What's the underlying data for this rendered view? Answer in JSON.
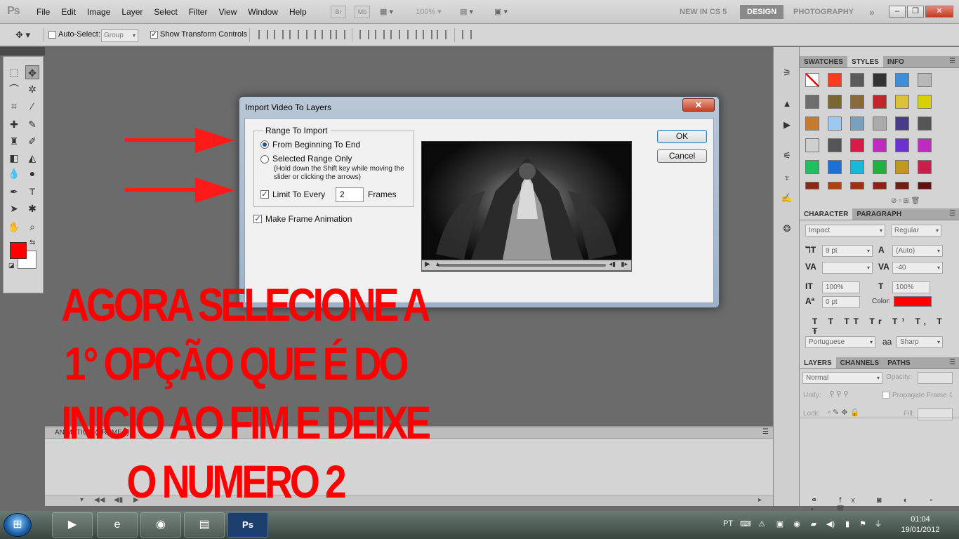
{
  "app": {
    "logo": "Ps",
    "menu": [
      "File",
      "Edit",
      "Image",
      "Layer",
      "Select",
      "Filter",
      "View",
      "Window",
      "Help"
    ],
    "bridge_btn": "Br",
    "minibridge_btn": "Mb",
    "zoom": "100%",
    "workspaces": [
      "NEW IN CS 5",
      "DESIGN",
      "PHOTOGRAPHY"
    ],
    "active_workspace": "DESIGN",
    "more": "»",
    "win_minimize": "–",
    "win_restore": "❐",
    "win_close": "✕"
  },
  "options_bar": {
    "auto_select_label": "Auto-Select:",
    "auto_select_checked": false,
    "group_value": "Group",
    "show_transform_label": "Show Transform Controls",
    "show_transform_checked": true
  },
  "animation_panel": {
    "title": "ANIMATION (FRAMES)"
  },
  "panels": {
    "swatches_tabs": [
      "SWATCHES",
      "STYLES",
      "INFO"
    ],
    "swatches_active": "STYLES",
    "character_tabs": [
      "CHARACTER",
      "PARAGRAPH"
    ],
    "character_active": "CHARACTER",
    "font_family": "Impact",
    "font_style": "Regular",
    "font_size": "9 pt",
    "leading": "(Auto)",
    "kerning": "",
    "tracking": "-40",
    "vertical_scale": "100%",
    "horizontal_scale": "100%",
    "baseline_shift": "0 pt",
    "color_label": "Color:",
    "text_color": "#ff0000",
    "language": "Portuguese",
    "aa_label": "aa",
    "antialias": "Sharp",
    "layers_tabs": [
      "LAYERS",
      "CHANNELS",
      "PATHS"
    ],
    "layers_active": "LAYERS",
    "blend_mode": "Normal",
    "opacity_label": "Opacity:",
    "unify_label": "Unify:",
    "propagate_label": "Propagate Frame 1",
    "lock_label": "Lock:",
    "fill_label": "Fill:"
  },
  "dialog": {
    "title": "Import Video To Layers",
    "close": "✕",
    "range_legend": "Range To Import",
    "option_all": "From Beginning To End",
    "option_all_selected": true,
    "option_range": "Selected Range Only",
    "option_range_selected": false,
    "hint": "(Hold down the Shift key while moving the slider or clicking the arrows)",
    "limit_label": "Limit To Every",
    "limit_checked": true,
    "limit_value": "2",
    "frames_label": "Frames",
    "make_anim_label": "Make Frame Animation",
    "make_anim_checked": true,
    "ok_label": "OK",
    "cancel_label": "Cancel"
  },
  "annotation": {
    "lines": [
      "AGORA SELECIONE A",
      "1° OPÇÃO QUE É DO",
      "INICIO AO FIM E DEIXE",
      "O NUMERO 2"
    ],
    "color": "#ff0000"
  },
  "taskbar": {
    "language": "PT",
    "time": "01:04",
    "date": "19/01/2012",
    "apps": [
      "media-player-icon",
      "internet-explorer-icon",
      "firefox-icon",
      "explorer-icon",
      "photoshop-icon"
    ],
    "photoshop_label": "Ps"
  },
  "colors": {
    "foreground": "#ff0000",
    "background": "#ffffff"
  }
}
